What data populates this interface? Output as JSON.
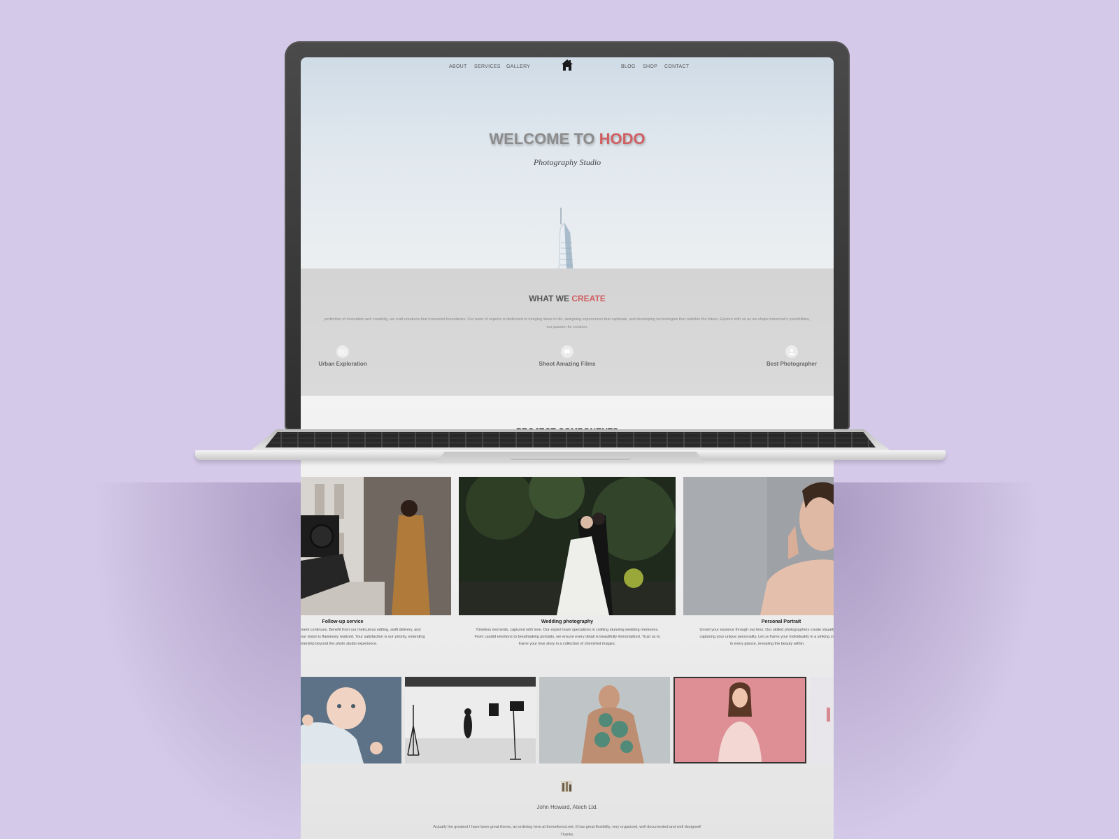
{
  "nav": {
    "left": [
      "ABOUT",
      "SERVICES",
      "GALLERY"
    ],
    "right": [
      "BLOG",
      "SHOP",
      "CONTACT"
    ],
    "home_icon": "home-icon"
  },
  "hero": {
    "title_prefix": "WELCOME TO ",
    "title_accent": "HODO",
    "subtitle": "Photography Studio"
  },
  "create": {
    "title_prefix": "WHAT WE ",
    "title_accent": "CREATE",
    "text_line1": "perfection of innovation and creativity, we craft creations that transcend boundaries. Our team of experts is dedicated to bringing ideas to life, designing experiences that captivate, and developing technologies that redefine the future. Explore with us as we shape tomorrow's possibilities,",
    "text_line2": "our passion for creation.",
    "features": [
      {
        "label": "Urban Exploration",
        "icon": "camera-icon"
      },
      {
        "label": "Shoot Amazing Films",
        "icon": "chat-icon"
      },
      {
        "label": "Best Photographer",
        "icon": "user-icon"
      }
    ]
  },
  "projects": {
    "title": "PROJECT COMPONENTS",
    "cards": [
      {
        "title": "Follow-up service",
        "desc1": "ment continues. Benefit from our meticulous editing, swift delivery, and",
        "desc2": "our vision is flawlessly realized. Your satisfaction is our priority, extending",
        "desc3": "tnership beyond the photo studio experience."
      },
      {
        "title": "Wedding photography",
        "desc1": "Timeless moments, captured with love. Our expert team specializes in crafting stunning wedding memories.",
        "desc2": "From candid emotions to breathtaking portraits, we ensure every detail is beautifully immortalized. Trust us to",
        "desc3": "frame your love story in a collection of cherished images."
      },
      {
        "title": "Personal Portrait",
        "desc1": "Unveil your essence through our lens. Our skilled photographers create visually",
        "desc2": "capturing your unique personality. Let us frame your individuality in a striking co",
        "desc3": "in every glance, revealing the beauty within."
      }
    ]
  },
  "testimonial": {
    "name": "John Howard, Atech Ltd.",
    "text_line1": "Actually the greatest I have been great theme, an ordering here at themeforest.net. It has great flexibility, very organized, well documented and well designed!",
    "text_line2": "Thanks."
  },
  "colors": {
    "accent": "#d05f62",
    "background": "#d4c9e8",
    "laptop_frame": "#3a3a3a"
  }
}
